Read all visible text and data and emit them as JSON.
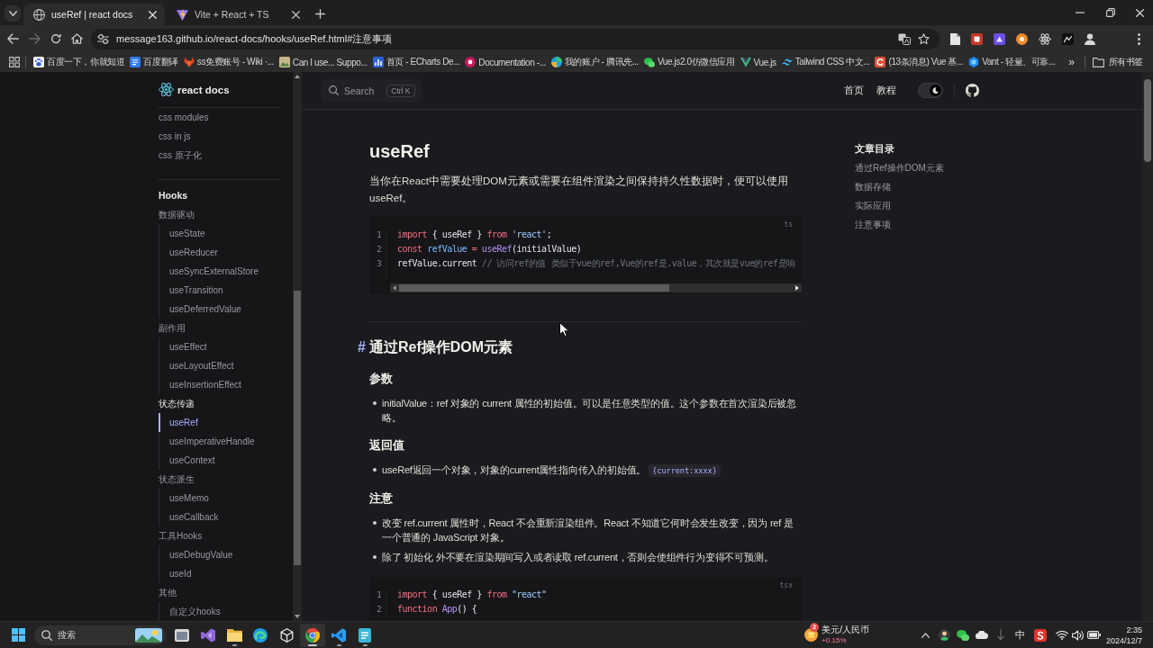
{
  "browser": {
    "tabs": [
      {
        "title": "useRef | react docs",
        "selected": true
      },
      {
        "title": "Vite + React + TS",
        "selected": false
      }
    ],
    "back": {
      "disabled": false
    },
    "forward": {
      "disabled": true
    },
    "url": "message163.github.io/react-docs/hooks/useRef.html#注意事项",
    "bookmarks": [
      "百度一下，你就知道",
      "百度翻译",
      "ss免费账号 - Wiki ·...",
      "Can I use... Suppo...",
      "首页 - ECharts De...",
      "Documentation -...",
      "我的账户 - 腾讯先...",
      "Vue.js2.0仿微信应用",
      "Vue.js",
      "Tailwind CSS 中文...",
      "(13条消息) Vue 基...",
      "Vant - 轻量、可靠..."
    ],
    "bookmarks_overflow": "»",
    "all_bookmarks": "所有书签"
  },
  "nav": {
    "search": {
      "label": "Search",
      "shortcut": "Ctrl K"
    },
    "links": [
      "首页",
      "教程"
    ],
    "dark_mode": true
  },
  "sidebar": {
    "title": "react docs",
    "sections": [
      {
        "items": [
          {
            "label": "css modules",
            "selected": false
          },
          {
            "label": "css in js",
            "selected": false
          },
          {
            "label": "css 原子化",
            "selected": false
          }
        ]
      },
      {
        "title": "Hooks",
        "items": [
          {
            "label": "数据驱动",
            "children": [
              {
                "label": "useState",
                "selected": false
              },
              {
                "label": "useReducer",
                "selected": false
              },
              {
                "label": "useSyncExternalStore",
                "selected": false
              },
              {
                "label": "useTransition",
                "selected": false
              },
              {
                "label": "useDeferredValue",
                "selected": false
              }
            ]
          },
          {
            "label": "副作用",
            "children": [
              {
                "label": "useEffect",
                "selected": false
              },
              {
                "label": "useLayoutEffect",
                "selected": false
              },
              {
                "label": "useInsertionEffect",
                "selected": false
              }
            ]
          },
          {
            "label": "状态传递",
            "children": [
              {
                "label": "useRef",
                "selected": true
              },
              {
                "label": "useImperativeHandle",
                "selected": false
              },
              {
                "label": "useContext",
                "selected": false
              }
            ]
          },
          {
            "label": "状态派生",
            "children": [
              {
                "label": "useMemo",
                "selected": false
              },
              {
                "label": "useCallback",
                "selected": false
              }
            ]
          },
          {
            "label": "工具Hooks",
            "children": [
              {
                "label": "useDebugValue",
                "selected": false
              },
              {
                "label": "useId",
                "selected": false
              }
            ]
          },
          {
            "label": "其他",
            "children": [
              {
                "label": "自定义hooks",
                "selected": false
              }
            ]
          }
        ]
      }
    ]
  },
  "article": {
    "blocks": [
      {
        "kind": "title",
        "text": "useRef"
      },
      {
        "kind": "paragraph",
        "text": "当你在React中需要处理DOM元素或需要在组件渲染之间保持持久性数据时，便可以使用useRef。"
      },
      {
        "kind": "code",
        "language": "ts",
        "scrollbar": true,
        "lines": [
          {
            "number": "1",
            "tokens": [
              {
                "text": "import",
                "kind": "keyword"
              },
              {
                "text": " { useRef } ",
                "kind": "plain"
              },
              {
                "text": "from",
                "kind": "keyword"
              },
              {
                "text": " 'react'",
                "kind": "string"
              },
              {
                "text": ";",
                "kind": "plain"
              }
            ]
          },
          {
            "number": "2",
            "tokens": [
              {
                "text": "const",
                "kind": "keyword"
              },
              {
                "text": " refValue",
                "kind": "variable"
              },
              {
                "text": " =",
                "kind": "operator"
              },
              {
                "text": " useRef",
                "kind": "function"
              },
              {
                "text": "(initialValue)",
                "kind": "plain"
              }
            ]
          },
          {
            "number": "3",
            "tokens": [
              {
                "text": "refValue.current ",
                "kind": "plain"
              },
              {
                "text": "// 访问ref的值 类似于vue的ref,Vue的ref是.value，其次就是vue的ref是响",
                "kind": "comment"
              }
            ]
          }
        ]
      },
      {
        "kind": "heading",
        "anchor": "#",
        "text": "通过Ref操作DOM元素"
      },
      {
        "kind": "subheading",
        "text": "参数"
      },
      {
        "kind": "list",
        "items": [
          {
            "parts": [
              {
                "kind": "text",
                "text": "initialValue：ref 对象的 current 属性的初始值。可以是任意类型的值。这个参数在首次渲染后被忽略。"
              }
            ]
          }
        ]
      },
      {
        "kind": "subheading",
        "text": "返回值"
      },
      {
        "kind": "list",
        "items": [
          {
            "parts": [
              {
                "kind": "text",
                "text": "useRef返回一个对象，对象的current属性指向传入的初始值。 "
              },
              {
                "kind": "code",
                "text": "{current:xxxx}"
              }
            ]
          }
        ]
      },
      {
        "kind": "subheading",
        "text": "注意"
      },
      {
        "kind": "list",
        "items": [
          {
            "parts": [
              {
                "kind": "text",
                "text": "改变 ref.current 属性时，React 不会重新渲染组件。React 不知道它何时会发生改变，因为 ref 是一个普通的 JavaScript 对象。"
              }
            ]
          },
          {
            "parts": [
              {
                "kind": "text",
                "text": "除了 初始化 外不要在渲染期间写入或者读取 ref.current，否则会使组件行为变得不可预测。"
              }
            ]
          }
        ]
      },
      {
        "kind": "code",
        "language": "tsx",
        "lines": [
          {
            "number": "1",
            "tokens": [
              {
                "text": "import",
                "kind": "keyword"
              },
              {
                "text": " { useRef } ",
                "kind": "plain"
              },
              {
                "text": "from",
                "kind": "keyword"
              },
              {
                "text": " \"react\"",
                "kind": "string"
              }
            ]
          },
          {
            "number": "2",
            "tokens": [
              {
                "text": "function",
                "kind": "keyword"
              },
              {
                "text": " App",
                "kind": "function"
              },
              {
                "text": "() {",
                "kind": "plain"
              }
            ]
          }
        ]
      }
    ]
  },
  "toc": {
    "title": "文章目录",
    "items": [
      "通过Ref操作DOM元素",
      "数据存储",
      "实际应用",
      "注意事项"
    ]
  },
  "taskbar": {
    "search": {
      "placeholder": "搜索"
    },
    "apps": [
      {
        "running": false,
        "selected": false
      },
      {
        "running": false,
        "selected": false
      },
      {
        "running": true,
        "selected": false
      },
      {
        "running": false,
        "selected": false
      },
      {
        "running": false,
        "selected": false
      },
      {
        "running": true,
        "selected": true
      },
      {
        "running": true,
        "selected": false
      },
      {
        "running": true,
        "selected": false
      }
    ],
    "widget": {
      "badge": "2",
      "title": "美元/人民币",
      "change": "+0.15%"
    },
    "ime": "中",
    "time": "2:35",
    "date": "2024/12/7"
  }
}
